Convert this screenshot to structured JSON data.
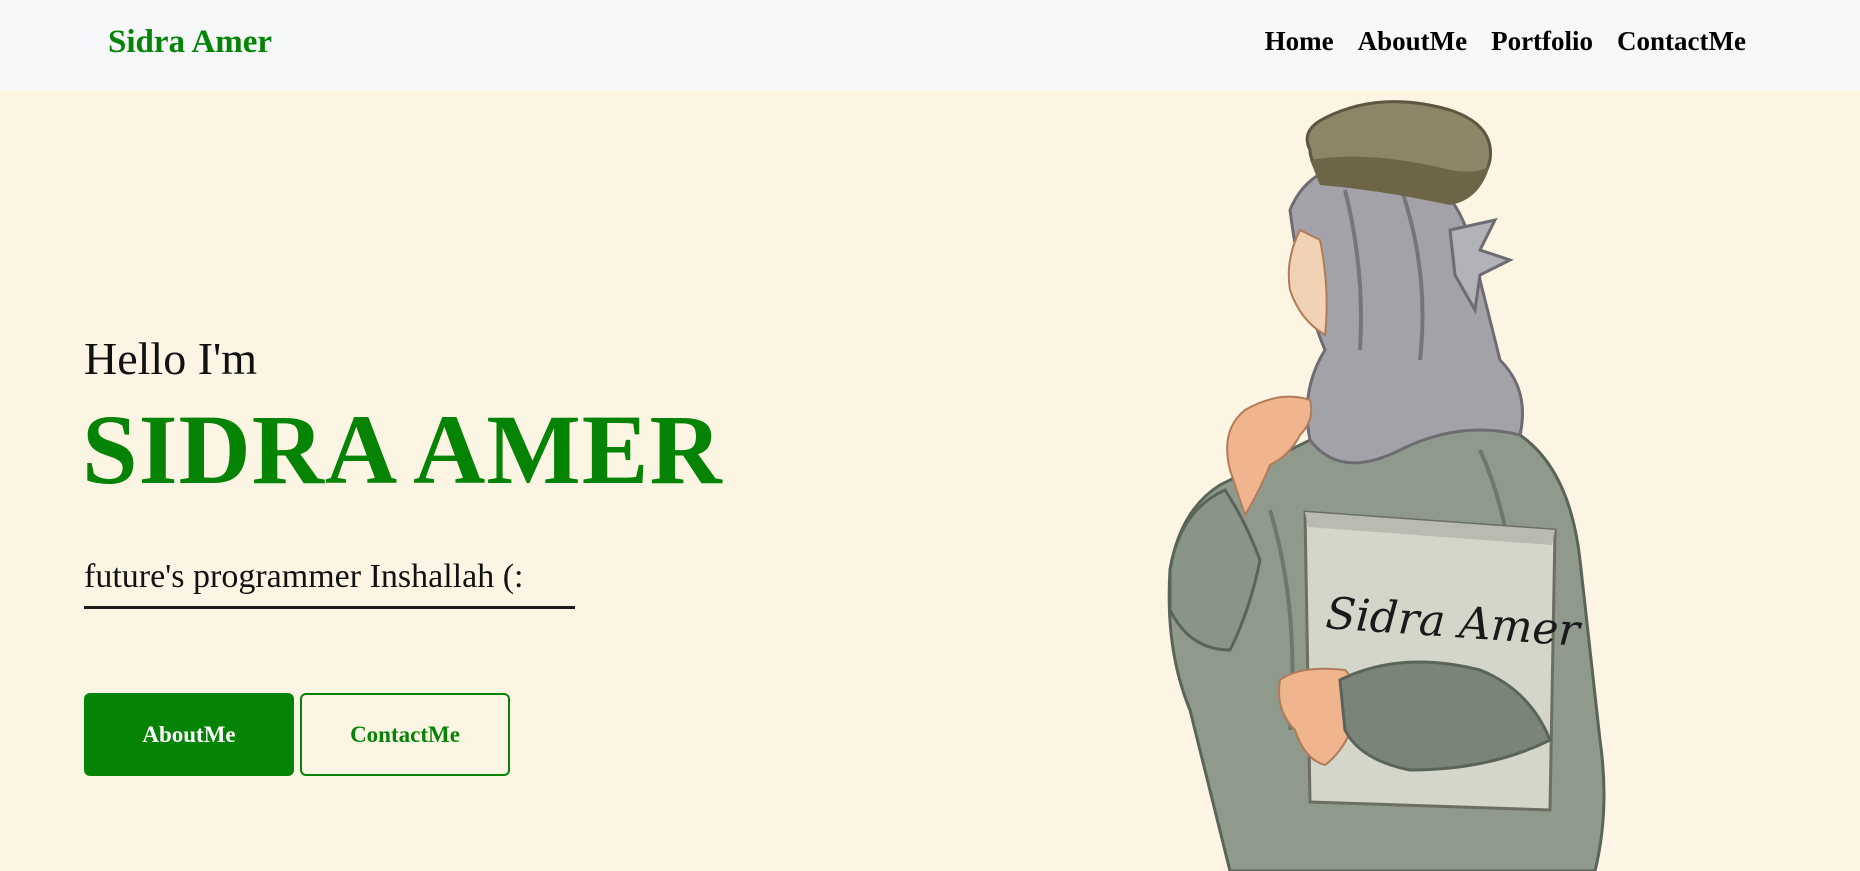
{
  "navbar": {
    "brand": "Sidra Amer",
    "links": [
      "Home",
      "AboutMe",
      "Portfolio",
      "ContactMe"
    ]
  },
  "hero": {
    "greeting": "Hello I'm",
    "name": "SIDRA AMER",
    "tagline": "future's programmer Inshallah (:",
    "primary_button": "AboutMe",
    "secondary_button": "ContactMe",
    "illustration": {
      "book_text": "Sidra Amer",
      "icon": "girl-with-book-illustration"
    }
  },
  "colors": {
    "accent": "#058305",
    "page_background": "#fdf5e4",
    "navbar_background": "#f6f8fa"
  }
}
